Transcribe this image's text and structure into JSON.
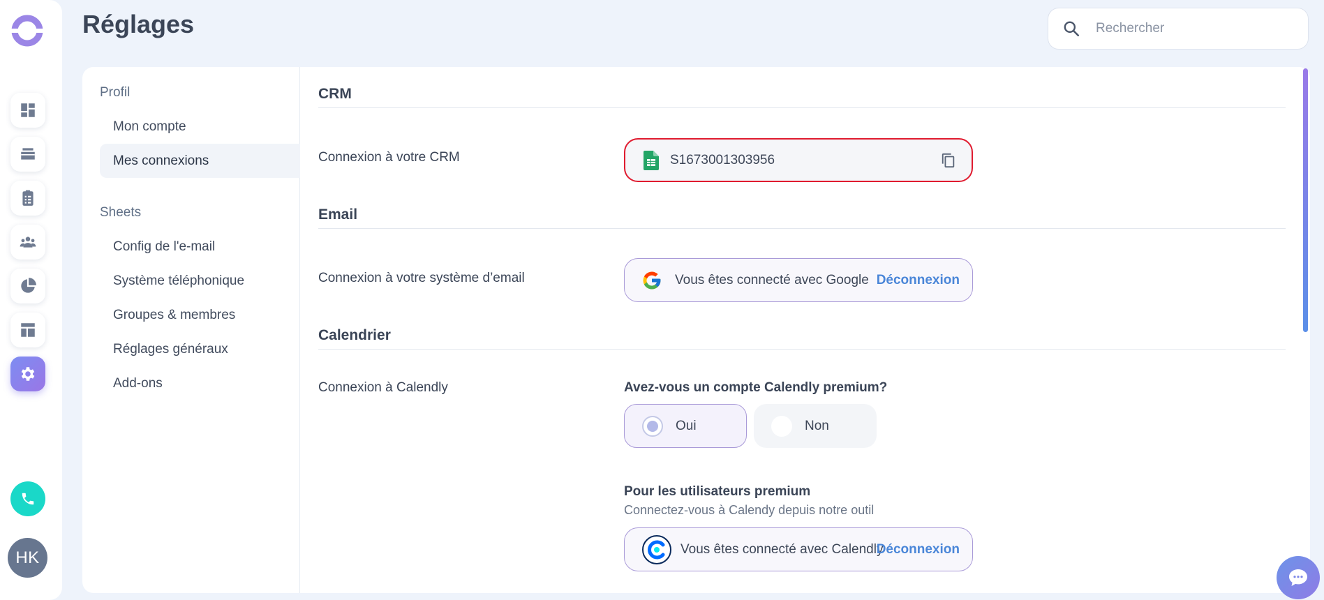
{
  "header": {
    "title": "Réglages",
    "search_placeholder": "Rechercher"
  },
  "rail": {
    "items": [
      "dashboard-icon",
      "inbox-icon",
      "tasks-icon",
      "team-icon",
      "stats-icon",
      "layout-icon",
      "settings-icon"
    ],
    "active": "settings-icon",
    "avatar_initials": "HK"
  },
  "subnav": {
    "groups": [
      {
        "label": "Profil",
        "items": [
          "Mon compte",
          "Mes connexions"
        ]
      },
      {
        "label": "Sheets",
        "items": [
          "Config de l'e-mail",
          "Système téléphonique",
          "Groupes & membres",
          "Réglages généraux",
          "Add-ons"
        ]
      }
    ],
    "selected": "Mes connexions"
  },
  "sections": {
    "crm": {
      "title": "CRM",
      "label": "Connexion à votre CRM",
      "sheet_id": "S1673001303956"
    },
    "email": {
      "title": "Email",
      "label": "Connexion à votre système d’email",
      "status": "Vous êtes connecté avec Google",
      "action": "Déconnexion"
    },
    "calendar": {
      "title": "Calendrier",
      "label": "Connexion à Calendly",
      "question": "Avez-vous un compte Calendly premium?",
      "options": [
        "Oui",
        "Non"
      ],
      "selected_option": "Oui",
      "premium_title": "Pour les utilisateurs premium",
      "premium_subtitle": "Connectez-vous à Calendy depuis notre outil",
      "status": "Vous êtes connecté avec Calendly",
      "action": "Déconnexion"
    }
  },
  "colors": {
    "accent": "#8a7fe8",
    "link": "#4a86d8",
    "highlight_border": "#e01b2f",
    "phone": "#1ad8c8"
  }
}
